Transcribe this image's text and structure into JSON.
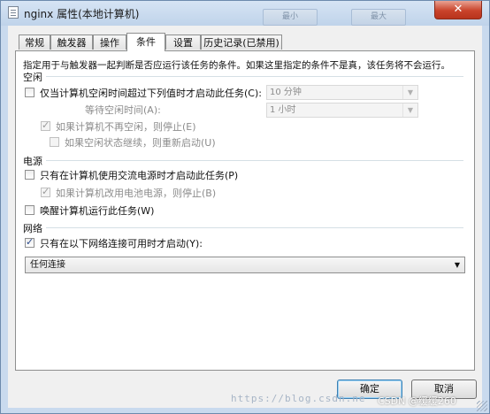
{
  "window": {
    "title": "nginx 属性(本地计算机)",
    "min_label": "最小",
    "max_label": "最大",
    "close_label": "✕"
  },
  "tabs": [
    {
      "label": "常规",
      "active": false
    },
    {
      "label": "触发器",
      "active": false
    },
    {
      "label": "操作",
      "active": false
    },
    {
      "label": "条件",
      "active": true
    },
    {
      "label": "设置",
      "active": false
    },
    {
      "label": "历史记录(已禁用)",
      "active": false
    }
  ],
  "conditions": {
    "description": "指定用于与触发器一起判断是否应运行该任务的条件。如果这里指定的条件不是真，该任务将不会运行。",
    "idle": {
      "section": "空闲",
      "start_if_idle": {
        "label": "仅当计算机空闲时间超过下列值时才启动此任务(C):",
        "checked": false
      },
      "idle_duration": "10 分钟",
      "wait_label": "等待空闲时间(A):",
      "wait_duration": "1 小时",
      "stop_if_not_idle": {
        "label": "如果计算机不再空闲，则停止(E)",
        "checked": true
      },
      "restart_if_idle": {
        "label": "如果空闲状态继续，则重新启动(U)",
        "checked": false
      }
    },
    "power": {
      "section": "电源",
      "ac_only": {
        "label": "只有在计算机使用交流电源时才启动此任务(P)",
        "checked": false
      },
      "stop_on_battery": {
        "label": "如果计算机改用电池电源，则停止(B)",
        "checked": true
      },
      "wake": {
        "label": "唤醒计算机运行此任务(W)",
        "checked": false
      }
    },
    "network": {
      "section": "网络",
      "only_if_network": {
        "label": "只有在以下网络连接可用时才启动(Y):",
        "checked": true
      },
      "connection": "任何连接"
    }
  },
  "buttons": {
    "ok": "确定",
    "cancel": "取消"
  },
  "overlay": {
    "watermark": "https://blog.csdn.ne",
    "credit": "CSDN @缓缓260"
  }
}
